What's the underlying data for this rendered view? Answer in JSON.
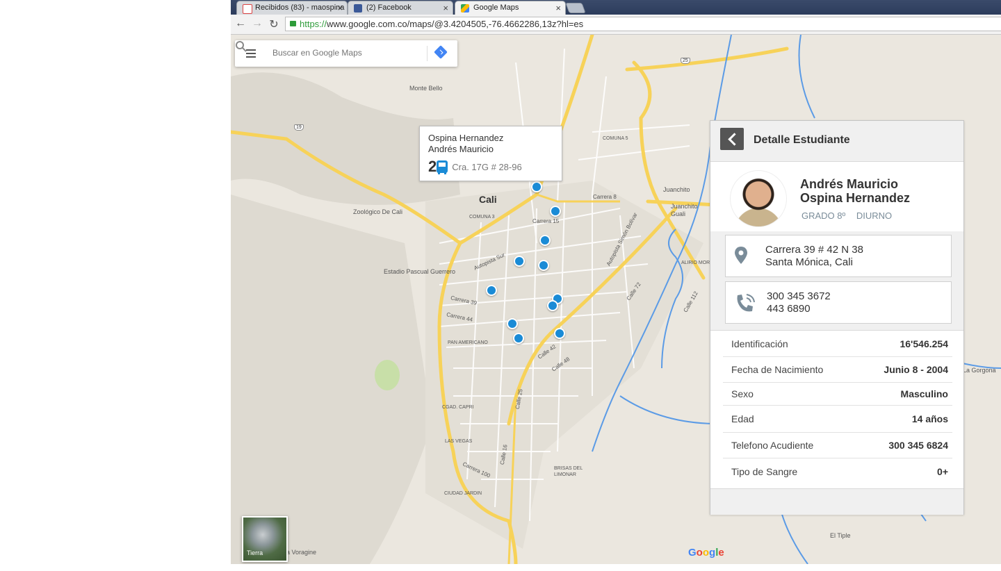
{
  "browser": {
    "tabs": [
      {
        "title": "Recibidos (83) - maospina",
        "favicon": "gmail-icon",
        "close": "×"
      },
      {
        "title": "(2) Facebook",
        "favicon": "facebook-icon",
        "close": "×"
      },
      {
        "title": "Google Maps",
        "favicon": "google-maps-icon",
        "close": "×"
      }
    ],
    "url_scheme": "https://",
    "url_rest": "www.google.com.co/maps/@3.4204505,-76.4662286,13z?hl=es"
  },
  "search": {
    "placeholder": "Buscar en Google Maps"
  },
  "map": {
    "labels": [
      {
        "text": "Monte Bello",
        "cls": ""
      },
      {
        "text": "Cali",
        "cls": "big"
      },
      {
        "text": "Zoológico De Cali",
        "cls": ""
      },
      {
        "text": "Estadio Pascual Guerrero",
        "cls": ""
      },
      {
        "text": "COMUNA 3",
        "cls": ""
      },
      {
        "text": "COMUNA 5",
        "cls": ""
      },
      {
        "text": "Carrera 8",
        "cls": ""
      },
      {
        "text": "Carrera 15",
        "cls": ""
      },
      {
        "text": "Carrera 39",
        "cls": ""
      },
      {
        "text": "Carrera 44",
        "cls": ""
      },
      {
        "text": "Autopista Simón Bolívar",
        "cls": ""
      },
      {
        "text": "Juanchito",
        "cls": ""
      },
      {
        "text": "Juanchito Guali",
        "cls": ""
      },
      {
        "text": "PAN AMERICANO",
        "cls": ""
      },
      {
        "text": "CGAD. CAPRI",
        "cls": ""
      },
      {
        "text": "LAS VEGAS",
        "cls": ""
      },
      {
        "text": "Carrera 100",
        "cls": ""
      },
      {
        "text": "CIUDAD JARDIN",
        "cls": ""
      },
      {
        "text": "BRISAS DEL LIMONAR",
        "cls": ""
      },
      {
        "text": "La Gorgona",
        "cls": ""
      },
      {
        "text": "El Tiple",
        "cls": ""
      },
      {
        "text": "a Voragine",
        "cls": ""
      },
      {
        "text": "Calle 25",
        "cls": ""
      },
      {
        "text": "Calle 16",
        "cls": ""
      },
      {
        "text": "Calle 42",
        "cls": ""
      },
      {
        "text": "Calle 48",
        "cls": ""
      },
      {
        "text": "Calle 72",
        "cls": ""
      },
      {
        "text": "Calle 112",
        "cls": ""
      },
      {
        "text": "ALIRIO MORA",
        "cls": ""
      },
      {
        "text": "Autopista Sur",
        "cls": ""
      }
    ],
    "shields": [
      "19",
      "25"
    ],
    "satellite_label": "Tierra",
    "google_logo": [
      "G",
      "o",
      "o",
      "g",
      "l",
      "e"
    ]
  },
  "popup": {
    "surname": "Ospina Hernandez",
    "given": "Andrés Mauricio",
    "route_number": "2",
    "address": "Cra. 17G # 28-96"
  },
  "panel": {
    "title": "Detalle Estudiante",
    "first_names": "Andrés Mauricio",
    "last_names": "Ospina Hernandez",
    "grade": "GRADO 8º",
    "shift": "DIURNO",
    "address_line1": "Carrera 39 # 42 N 38",
    "address_line2": "Santa Mónica, Cali",
    "phone1": "300 345 3672",
    "phone2": "443 6890",
    "details": [
      {
        "label": "Identificación",
        "value": "16'546.254"
      },
      {
        "label": "Fecha de Nacimiento",
        "value": "Junio 8 - 2004"
      },
      {
        "label": "Sexo",
        "value": "Masculino"
      },
      {
        "label": "Edad",
        "value": "14 años"
      },
      {
        "label": "Telefono Acudiente",
        "value": "300 345 6824"
      },
      {
        "label": "Tipo de Sangre",
        "value": "0+"
      }
    ]
  },
  "colors": {
    "pin": "#1a8bd6",
    "highway": "#f7d259",
    "water": "#5b9be6",
    "park": "#c8dfa8"
  }
}
